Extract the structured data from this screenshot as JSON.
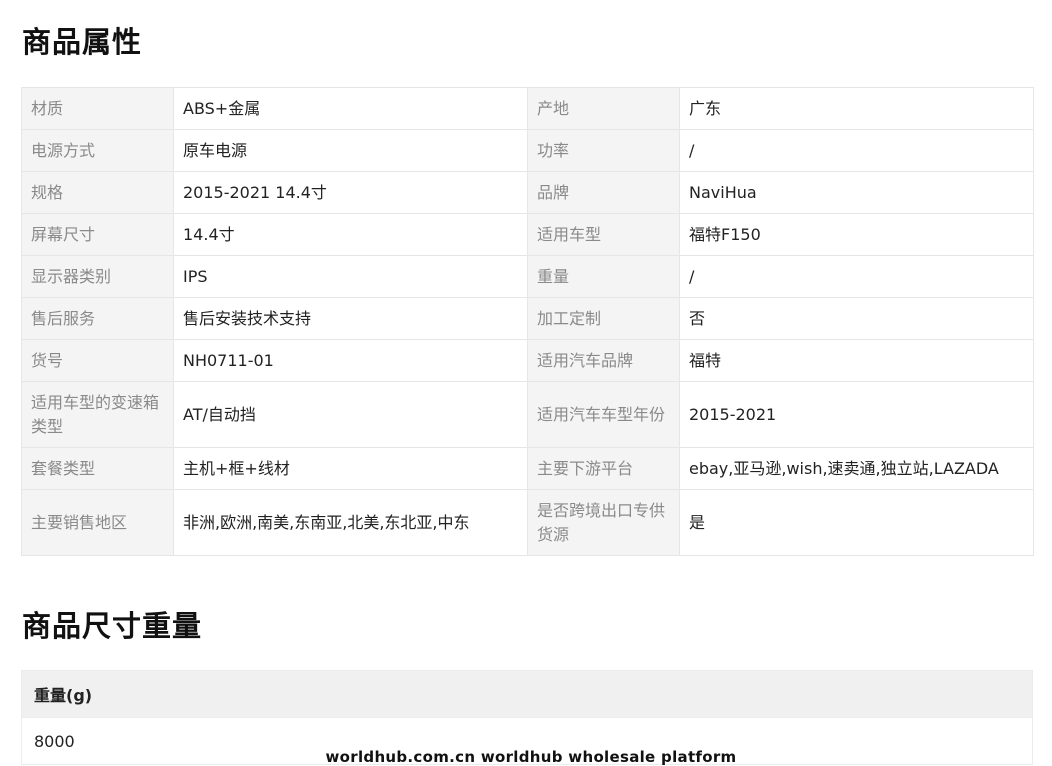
{
  "sections": {
    "attributes_title": "商品属性",
    "size_weight_title": "商品尺寸重量"
  },
  "attributes": [
    {
      "k1": "材质",
      "v1": "ABS+金属",
      "k2": "产地",
      "v2": "广东"
    },
    {
      "k1": "电源方式",
      "v1": "原车电源",
      "k2": "功率",
      "v2": "/"
    },
    {
      "k1": "规格",
      "v1": "2015-2021 14.4寸",
      "k2": "品牌",
      "v2": "NaviHua"
    },
    {
      "k1": "屏幕尺寸",
      "v1": "14.4寸",
      "k2": "适用车型",
      "v2": "福特F150"
    },
    {
      "k1": "显示器类别",
      "v1": "IPS",
      "k2": "重量",
      "v2": "/"
    },
    {
      "k1": "售后服务",
      "v1": "售后安装技术支持",
      "k2": "加工定制",
      "v2": "否"
    },
    {
      "k1": "货号",
      "v1": "NH0711-01",
      "k2": "适用汽车品牌",
      "v2": "福特"
    },
    {
      "k1": "适用车型的变速箱类型",
      "v1": "AT/自动挡",
      "k2": "适用汽车车型年份",
      "v2": "2015-2021"
    },
    {
      "k1": "套餐类型",
      "v1": "主机+框+线材",
      "k2": "主要下游平台",
      "v2": "ebay,亚马逊,wish,速卖通,独立站,LAZADA"
    },
    {
      "k1": "主要销售地区",
      "v1": "非洲,欧洲,南美,东南亚,北美,东北亚,中东",
      "k2": "是否跨境出口专供货源",
      "v2": "是"
    }
  ],
  "size_weight": {
    "header": "重量(g)",
    "value": "8000"
  },
  "watermark": "worldhub.com.cn worldhub wholesale platform"
}
